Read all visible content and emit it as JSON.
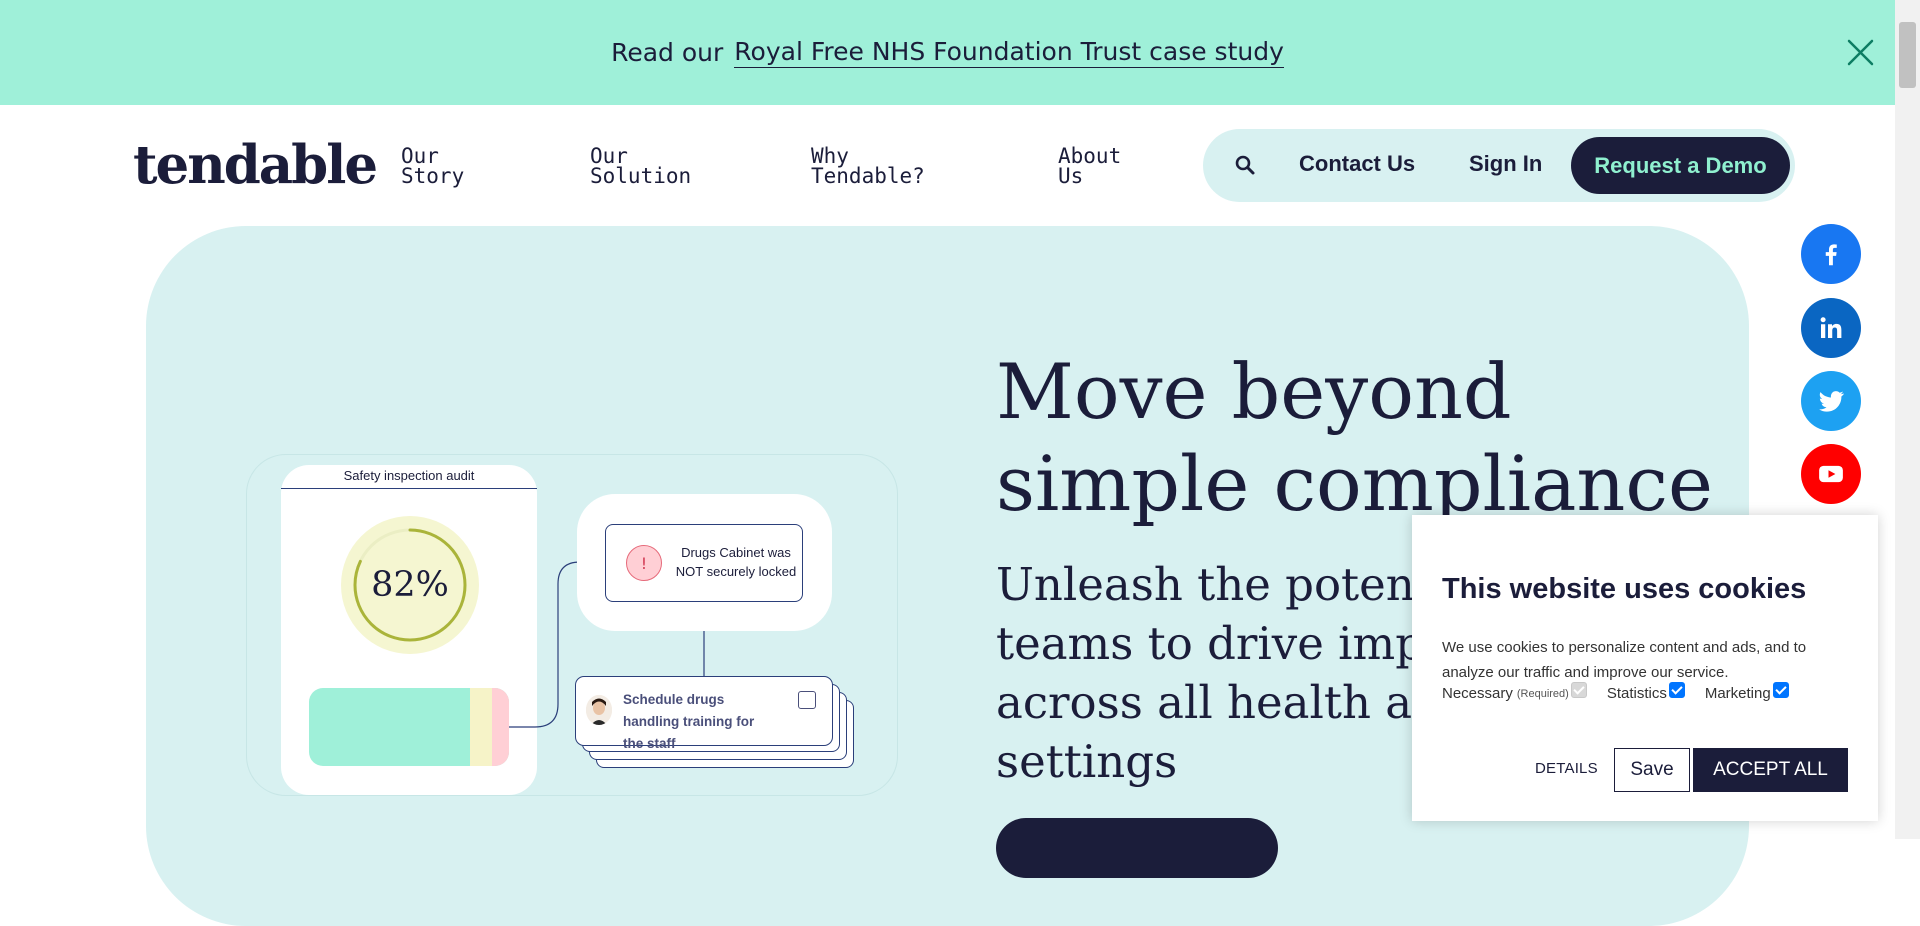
{
  "banner": {
    "lead": "Read our",
    "link": "Royal Free NHS Foundation Trust case study",
    "close_icon": "close-icon"
  },
  "header": {
    "logo": "tendable",
    "nav": [
      {
        "line1": "Our",
        "line2": "Story"
      },
      {
        "line1": "Our",
        "line2": "Solution"
      },
      {
        "line1": "Why",
        "line2": "Tendable?"
      },
      {
        "line1": "About",
        "line2": "Us"
      }
    ],
    "search_icon": "search-icon",
    "contact": "Contact Us",
    "signin": "Sign In",
    "demo": "Request a Demo"
  },
  "social": [
    "facebook-icon",
    "linkedin-icon",
    "twitter-icon",
    "youtube-icon"
  ],
  "hero": {
    "title_line1": "Move beyond",
    "title_line2": "simple compliance",
    "sub_lines": [
      "Unleash the potential of",
      "teams to drive improvement",
      "across all health and",
      "settings"
    ]
  },
  "illustration": {
    "audit_title": "Safety inspection audit",
    "score": "82%",
    "score_value": 0.82,
    "alert_text": "Drugs Cabinet was NOT securely locked",
    "task_text": "Schedule drugs handling training for the staff"
  },
  "cookie": {
    "title": "This website uses cookies",
    "description": "We use cookies to personalize content and ads, and to analyze our traffic and improve our service.",
    "necessary": "Necessary",
    "required": "(Required)",
    "statistics": "Statistics",
    "marketing": "Marketing",
    "details": "DETAILS",
    "save": "Save",
    "accept": "ACCEPT ALL"
  },
  "colors": {
    "navy": "#1b1d3a",
    "mint": "#9ff0d9",
    "hero_bg": "#d8f1f1",
    "facebook": "#1877f2",
    "linkedin": "#0a66c2",
    "twitter": "#1da1f2",
    "youtube": "#ff0000"
  }
}
